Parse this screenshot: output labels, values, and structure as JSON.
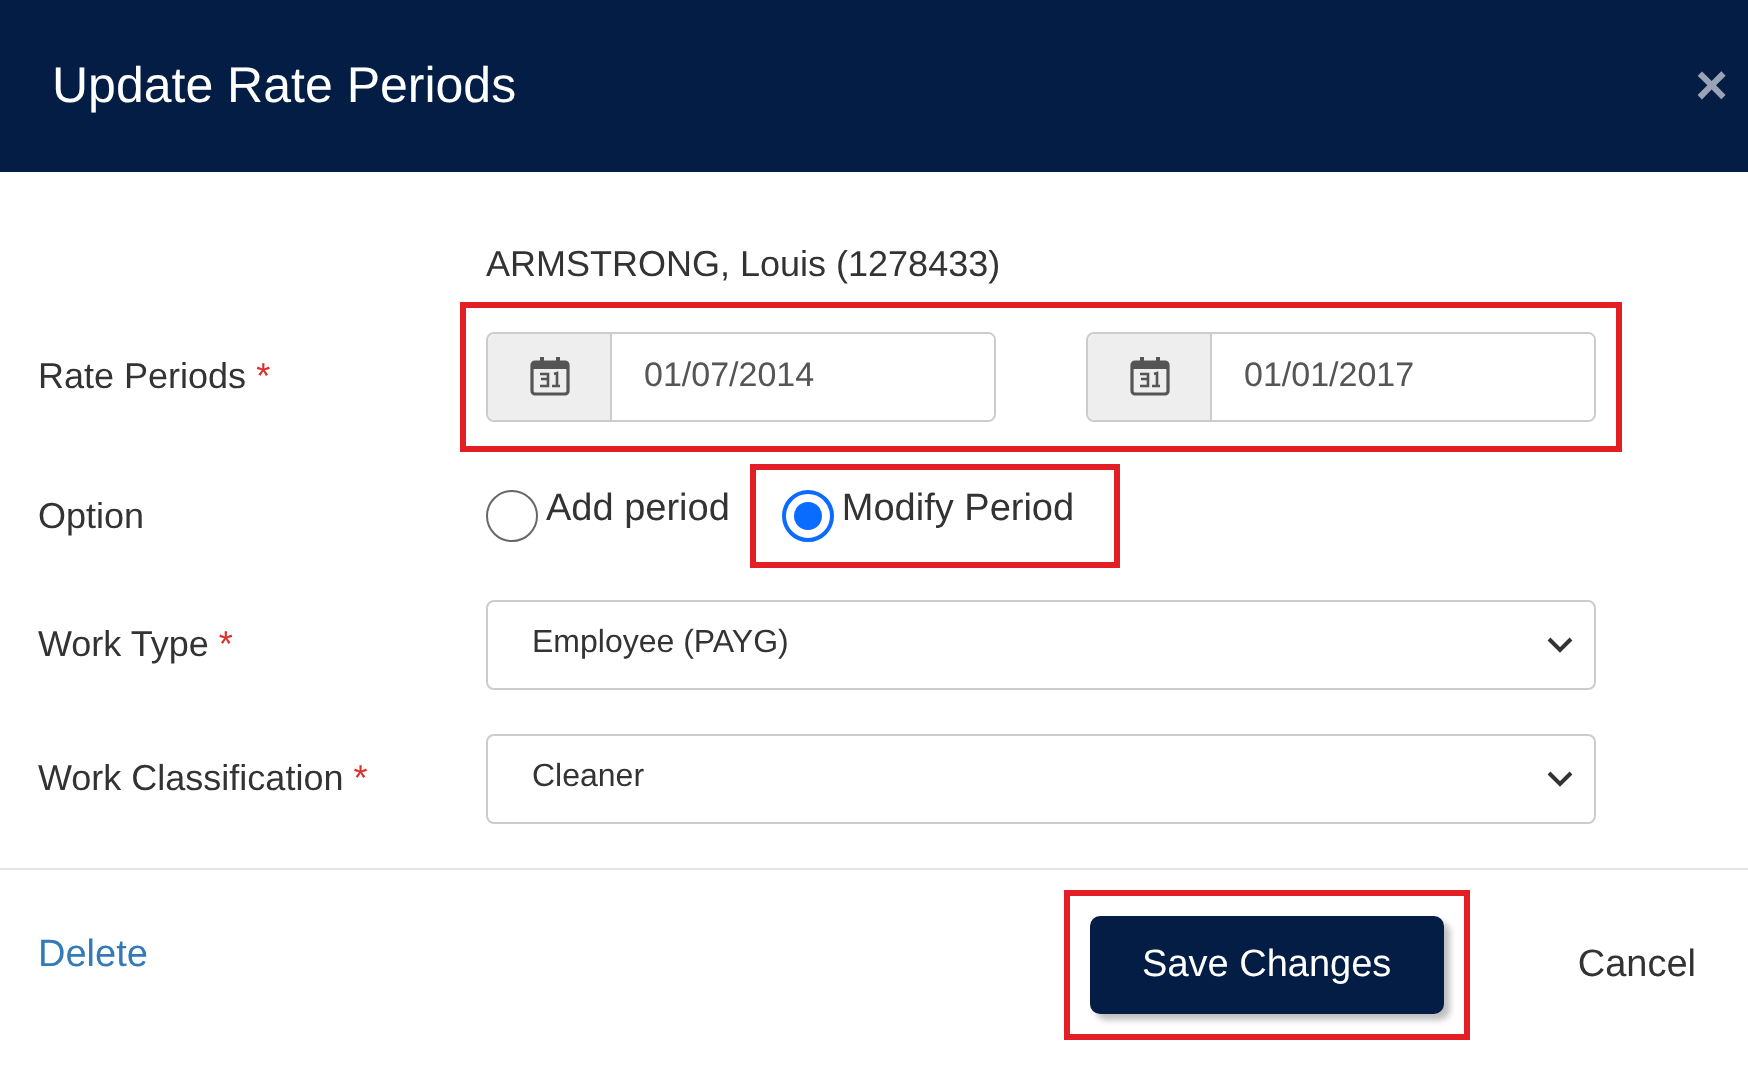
{
  "dialog": {
    "title": "Update Rate Periods",
    "close": "×"
  },
  "employee": "ARMSTRONG, Louis (1278433)",
  "rate_periods": {
    "label": "Rate Periods",
    "required_mark": "*",
    "highlighted": true,
    "start": "01/07/2014",
    "end": "01/01/2017"
  },
  "option": {
    "label": "Option",
    "highlighted_choice": true,
    "choices": [
      {
        "label": "Add period",
        "selected": false
      },
      {
        "label": "Modify Period",
        "selected": true
      }
    ]
  },
  "work_type": {
    "label": "Work Type",
    "required_mark": "*",
    "value": "Employee (PAYG)"
  },
  "work_classification": {
    "label": "Work Classification",
    "required_mark": "*",
    "value": "Cleaner"
  },
  "footer": {
    "delete": "Delete",
    "save": "Save Changes",
    "save_highlighted": true,
    "cancel": "Cancel"
  }
}
